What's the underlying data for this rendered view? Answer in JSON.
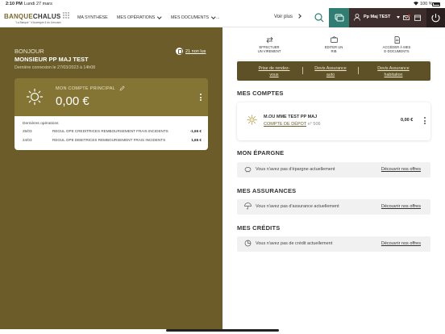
{
  "status": {
    "time": "2:10 PM",
    "date": "Lundi 27 mars",
    "battery": "100 %"
  },
  "nav": {
    "logo_brand_part1": "BANQUE",
    "logo_brand_part2": "CHALUS",
    "logo_tagline": "\"La Banque \" d'Auvergne & du Limousin",
    "items": [
      "MA SYNTHÈSE",
      "MES OPÉRATIONS",
      "MES DOCUMENTS",
      "..."
    ],
    "voir_plus": "Voir plus",
    "user_name": "Pp Maj TEST"
  },
  "welcome": {
    "greeting": "BONJOUR",
    "name": "MONSIEUR PP MAJ TEST",
    "last_login": "Dernière connexion le 27/03/2023 à 14h08",
    "unread": "21 non lus"
  },
  "main_account": {
    "label": "MON COMPTE PRINCIPAL",
    "balance": "0,00 €",
    "ops_title": "Dernières opérations",
    "operations": [
      {
        "date": "25/03",
        "label": "REGUL OPE CREDITRICES REMBOURSEMENT FRAIS INCIDENTS",
        "amount": "-1,65 €"
      },
      {
        "date": "24/03",
        "label": "REGUL OPE DEBITRICES REMBOURSEMENT FRAIS INCIDENTS",
        "amount": "1,65 €"
      }
    ]
  },
  "quick_actions": [
    {
      "line1": "EFFECTUER",
      "line2": "UN VIREMENT"
    },
    {
      "line1": "EDITER UN",
      "line2": "RIB"
    },
    {
      "line1": "ACCÉDER À MES",
      "line2": "E-DOCUMENTS"
    }
  ],
  "links": [
    {
      "line1": "Prise de rendez-",
      "line2": "vous"
    },
    {
      "line1": "Devis Assurance",
      "line2": "auto"
    },
    {
      "line1": "Devis Assurance",
      "line2": "habitation"
    }
  ],
  "sections": {
    "comptes": {
      "title": "MES COMPTES",
      "account_name": "M.OU MME TEST PP MAJ",
      "account_type": "COMPTE DE DÉPOT",
      "account_number": "n° 506",
      "balance": "0,00 €"
    },
    "epargne": {
      "title": "MON ÉPARGNE",
      "text": "Vous n'avez pas d'épargne actuellement",
      "link": "Découvrir nos offres"
    },
    "assurances": {
      "title": "MES ASSURANCES",
      "text": "Vous n'avez pas d'assurance actuellement",
      "link": "Découvrir nos offres"
    },
    "credits": {
      "title": "MES CRÉDITS",
      "text": "Vous n'avez pas de crédit actuellement",
      "link": "Découvrir nos offres"
    }
  }
}
